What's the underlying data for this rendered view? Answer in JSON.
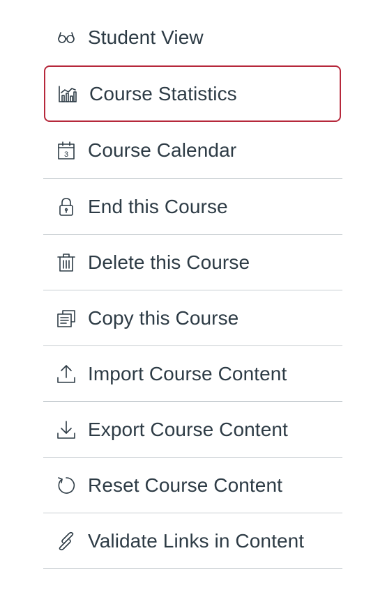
{
  "menu": {
    "items": [
      {
        "id": "student-view",
        "label": "Student View",
        "icon": "glasses-icon"
      },
      {
        "id": "course-statistics",
        "label": "Course Statistics",
        "icon": "statistics-icon",
        "highlighted": true
      },
      {
        "id": "course-calendar",
        "label": "Course Calendar",
        "icon": "calendar-icon",
        "calendar_day": "3"
      },
      {
        "id": "end-course",
        "label": "End this Course",
        "icon": "lock-icon"
      },
      {
        "id": "delete-course",
        "label": "Delete this Course",
        "icon": "trash-icon"
      },
      {
        "id": "copy-course",
        "label": "Copy this Course",
        "icon": "copy-icon"
      },
      {
        "id": "import-content",
        "label": "Import Course Content",
        "icon": "upload-icon"
      },
      {
        "id": "export-content",
        "label": "Export Course Content",
        "icon": "download-icon"
      },
      {
        "id": "reset-content",
        "label": "Reset Course Content",
        "icon": "reset-icon"
      },
      {
        "id": "validate-links",
        "label": "Validate Links in Content",
        "icon": "link-icon"
      }
    ]
  },
  "colors": {
    "text": "#2D3B45",
    "highlight_border": "#B6283B",
    "divider": "#C7CDD1"
  }
}
